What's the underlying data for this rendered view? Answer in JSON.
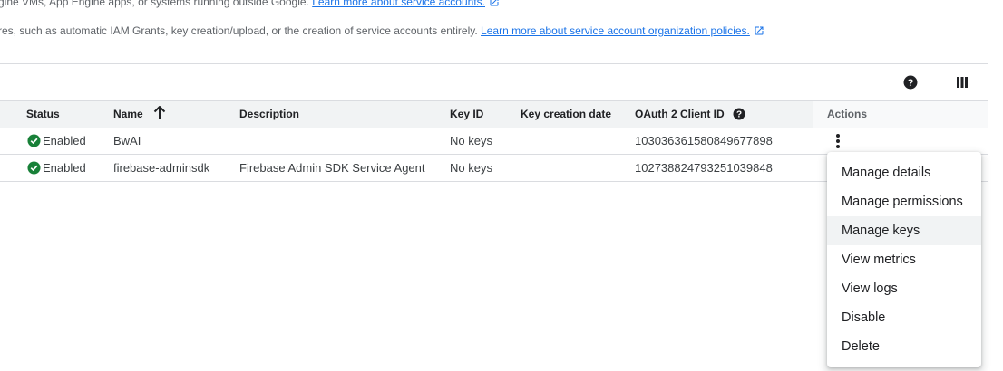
{
  "intro": {
    "line1_text": "gine VMs, App Engine apps, or systems running outside Google.",
    "line1_link": "Learn more about service accounts.",
    "line2_text": "res, such as automatic IAM Grants, key creation/upload, or the creation of service accounts entirely.",
    "line2_link": "Learn more about service account organization policies."
  },
  "toolbar": {
    "help_icon": "help-icon",
    "columns_icon": "column-display-icon"
  },
  "table": {
    "columns": {
      "status": "Status",
      "name": "Name",
      "description": "Description",
      "key_id": "Key ID",
      "key_creation_date": "Key creation date",
      "oauth_client_id": "OAuth 2 Client ID",
      "actions": "Actions"
    },
    "sort": {
      "column": "name",
      "direction": "ascending"
    },
    "rows": [
      {
        "status": "Enabled",
        "name": "BwAI",
        "description": "",
        "key_id": "No keys",
        "key_creation_date": "",
        "oauth_client_id": "103036361580849677898"
      },
      {
        "status": "Enabled",
        "name": "firebase-adminsdk",
        "description": "Firebase Admin SDK Service Agent",
        "key_id": "No keys",
        "key_creation_date": "",
        "oauth_client_id": "102738824793251039848"
      }
    ]
  },
  "actions_menu": {
    "items": [
      "Manage details",
      "Manage permissions",
      "Manage keys",
      "View metrics",
      "View logs",
      "Disable",
      "Delete"
    ],
    "hovered": "Manage keys"
  },
  "colors": {
    "link": "#1a73e8",
    "status_enabled": "#188038",
    "header_bg": "#f1f3f4"
  }
}
